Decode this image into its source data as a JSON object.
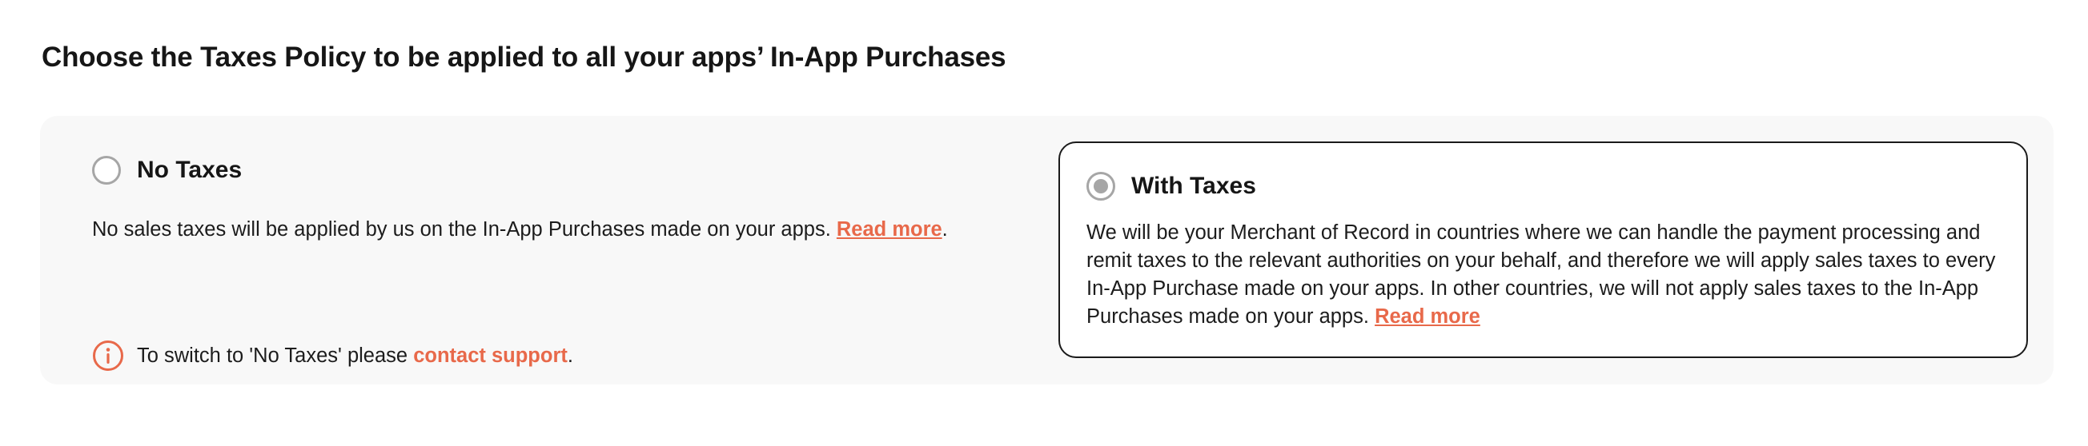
{
  "page": {
    "title": "Choose the Taxes Policy to be applied to all your apps’ In-App Purchases"
  },
  "options": {
    "no_taxes": {
      "title": "No Taxes",
      "selected": false,
      "description": "No sales taxes will be applied by us on the In-App Purchases made on your apps.",
      "read_more": "Read more",
      "trailing": ".",
      "notice": {
        "icon": "info-icon",
        "text_before": "To switch to 'No Taxes' please",
        "link": "contact support",
        "text_after": "."
      }
    },
    "with_taxes": {
      "title": "With Taxes",
      "selected": true,
      "description": "We will be your Merchant of Record in countries where we can handle the payment processing and remit taxes to the relevant authorities on your behalf, and therefore we will apply sales taxes to every In-App Purchase made on your apps. In other countries, we will not apply sales taxes to the In-App Purchases made on your apps.",
      "read_more": "Read more"
    }
  },
  "colors": {
    "accent": "#e8694a",
    "panel_background": "#f8f8f8",
    "radio_border": "#a6a6a6",
    "selected_border": "#1a1a1a",
    "text": "#1c1c1c"
  }
}
